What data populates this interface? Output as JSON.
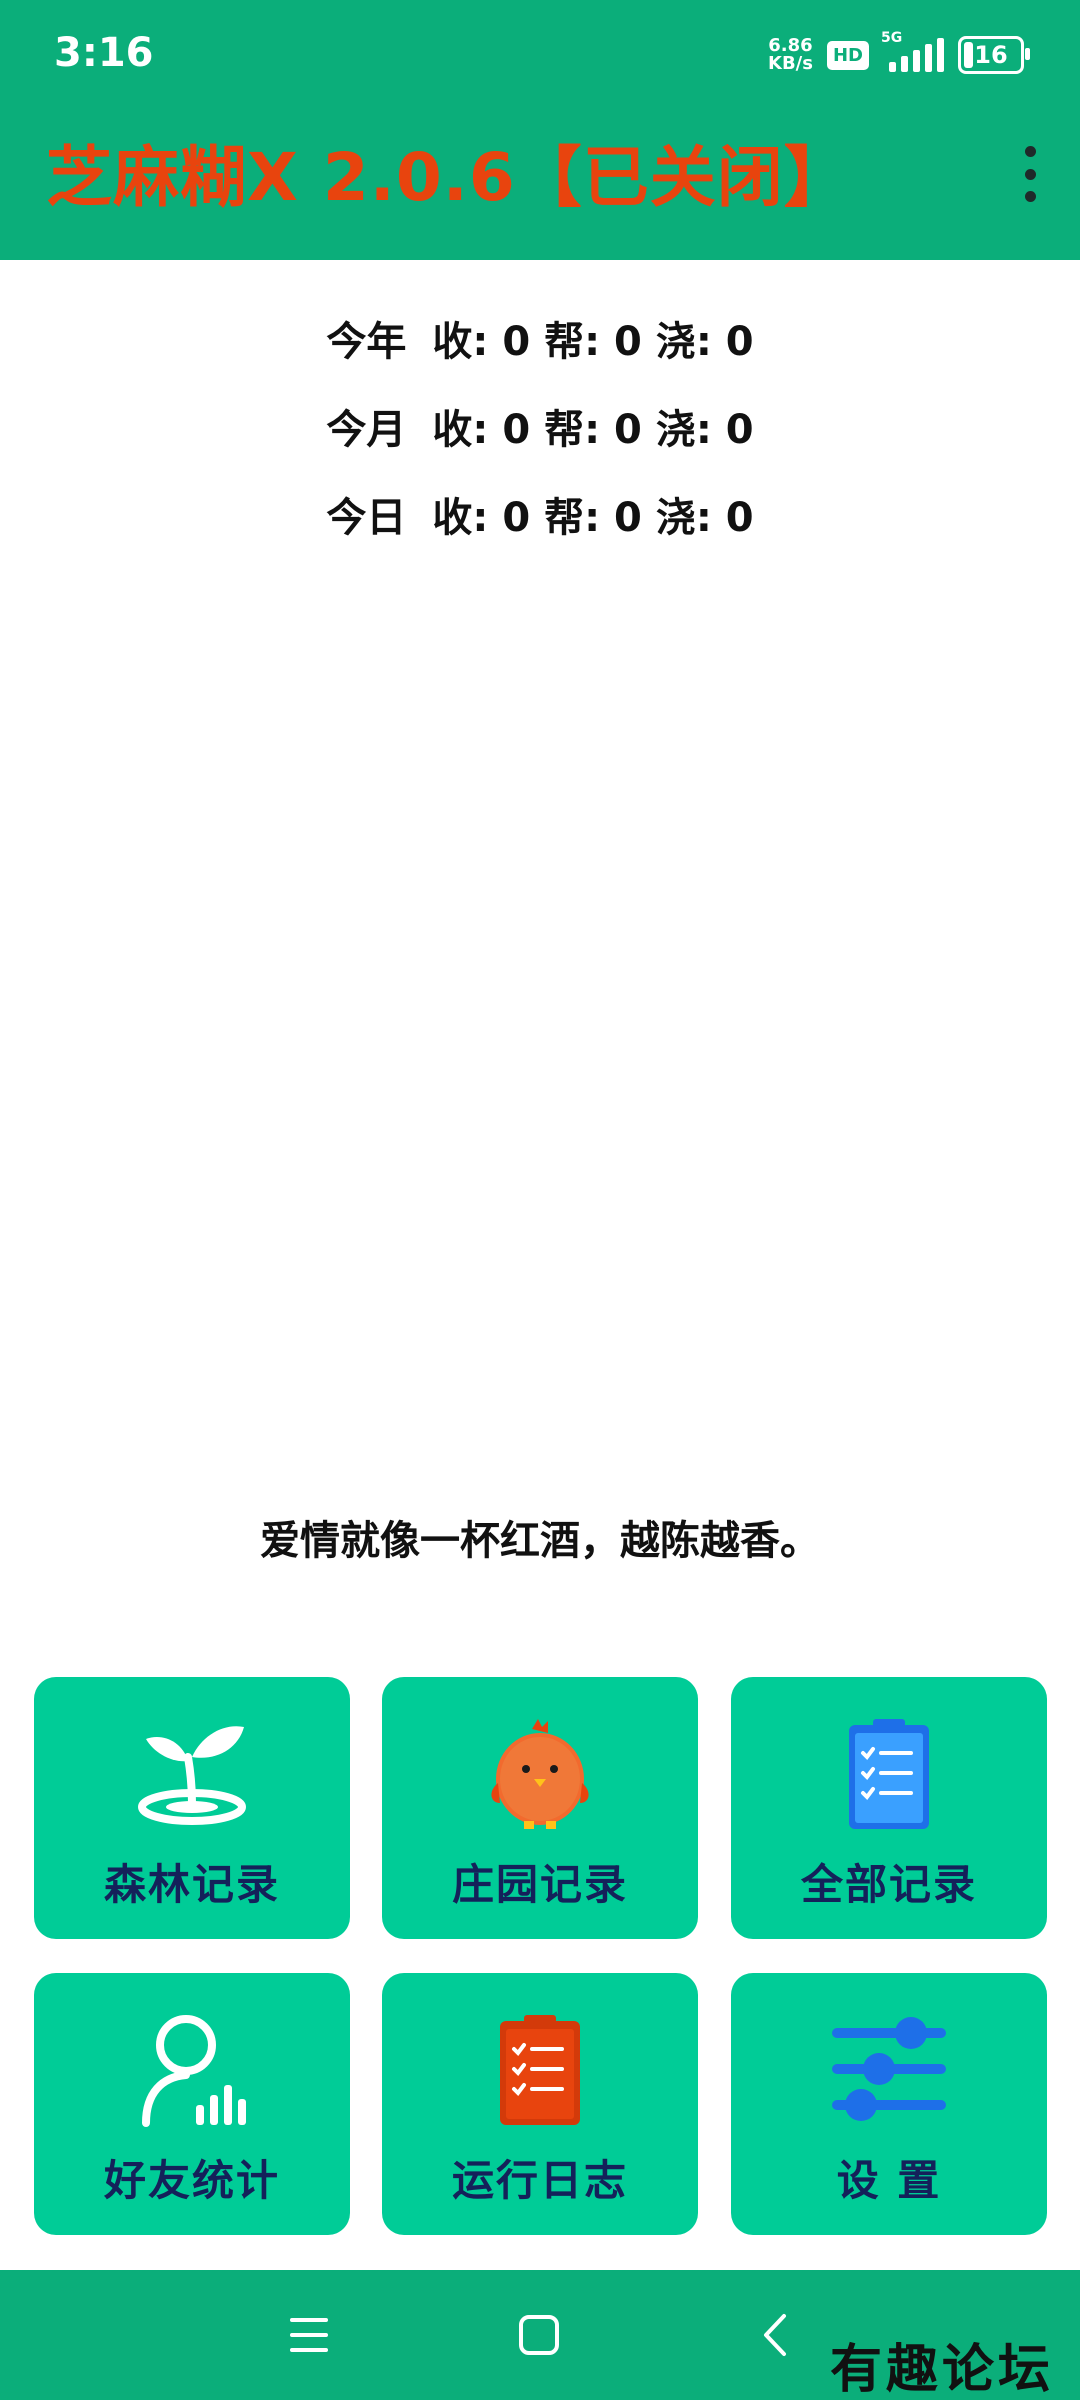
{
  "status_bar": {
    "time": "3:16",
    "net_speed_value": "6.86",
    "net_speed_unit": "KB/s",
    "hd_label": "HD",
    "network_label": "5G",
    "battery_level": "16"
  },
  "header": {
    "title": "芝麻糊X 2.0.6【已关闭】",
    "title_color": "#E8440E",
    "background_color": "#0BAE7A"
  },
  "stats": [
    {
      "period": "今年",
      "shou_label": "收:",
      "shou": "0",
      "bang_label": "帮:",
      "bang": "0",
      "jiao_label": "浇:",
      "jiao": "0"
    },
    {
      "period": "今月",
      "shou_label": "收:",
      "shou": "0",
      "bang_label": "帮:",
      "bang": "0",
      "jiao_label": "浇:",
      "jiao": "0"
    },
    {
      "period": "今日",
      "shou_label": "收:",
      "shou": "0",
      "bang_label": "帮:",
      "bang": "0",
      "jiao_label": "浇:",
      "jiao": "0"
    }
  ],
  "quote": "爱情就像一杯红酒，越陈越香。",
  "tiles": [
    {
      "label": "森林记录",
      "icon": "sprout-icon"
    },
    {
      "label": "庄园记录",
      "icon": "chick-icon"
    },
    {
      "label": "全部记录",
      "icon": "clipboard-checklist-icon"
    },
    {
      "label": "好友统计",
      "icon": "user-stats-icon"
    },
    {
      "label": "运行日志",
      "icon": "log-clipboard-icon"
    },
    {
      "label": "设 置",
      "icon": "sliders-icon"
    }
  ],
  "tile_color": "#00CC97",
  "watermark": "有趣论坛"
}
